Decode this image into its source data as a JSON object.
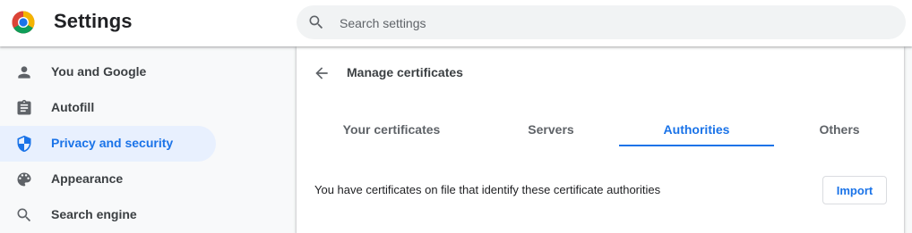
{
  "header": {
    "title": "Settings",
    "search_placeholder": "Search settings"
  },
  "sidebar": {
    "items": [
      {
        "label": "You and Google",
        "icon": "person-icon"
      },
      {
        "label": "Autofill",
        "icon": "clipboard-icon"
      },
      {
        "label": "Privacy and security",
        "icon": "shield-icon",
        "active": true
      },
      {
        "label": "Appearance",
        "icon": "palette-icon"
      },
      {
        "label": "Search engine",
        "icon": "search-icon"
      }
    ]
  },
  "main": {
    "title": "Manage certificates",
    "tabs": [
      {
        "label": "Your certificates"
      },
      {
        "label": "Servers"
      },
      {
        "label": "Authorities",
        "active": true
      },
      {
        "label": "Others"
      }
    ],
    "description": "You have certificates on file that identify these certificate authorities",
    "import_label": "Import"
  },
  "colors": {
    "accent": "#1a73e8",
    "active_nav_bg": "#e8f0fe",
    "page_bg": "#f8f9fa"
  }
}
